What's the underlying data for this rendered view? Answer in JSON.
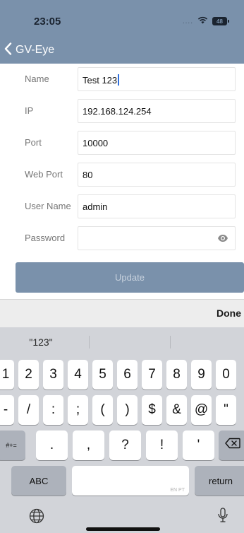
{
  "status_bar": {
    "time": "23:05",
    "signal": "....",
    "battery": "48"
  },
  "nav": {
    "back_label": "GV-Eye"
  },
  "form": {
    "fields": [
      {
        "label": "Name",
        "value": "Test 123"
      },
      {
        "label": "IP",
        "value": "192.168.124.254"
      },
      {
        "label": "Port",
        "value": "10000"
      },
      {
        "label": "Web Port",
        "value": "80"
      },
      {
        "label": "User Name",
        "value": "admin"
      },
      {
        "label": "Password",
        "value": ""
      }
    ],
    "update_label": "Update"
  },
  "accessory": {
    "done_label": "Done"
  },
  "keyboard": {
    "suggestions": [
      "\"123\"",
      "",
      ""
    ],
    "row1": [
      "1",
      "2",
      "3",
      "4",
      "5",
      "6",
      "7",
      "8",
      "9",
      "0"
    ],
    "row2": [
      "-",
      "/",
      ":",
      ";",
      "(",
      ")",
      "$",
      "&",
      "@",
      "\""
    ],
    "row3": [
      "#+=",
      ".",
      ",",
      "?",
      "!",
      "'"
    ],
    "row4": {
      "abc": "ABC",
      "space_hint": "EN PT",
      "return": "return"
    }
  },
  "colors": {
    "header": "#7a91ab",
    "keyboard_bg": "#d2d4d9"
  }
}
